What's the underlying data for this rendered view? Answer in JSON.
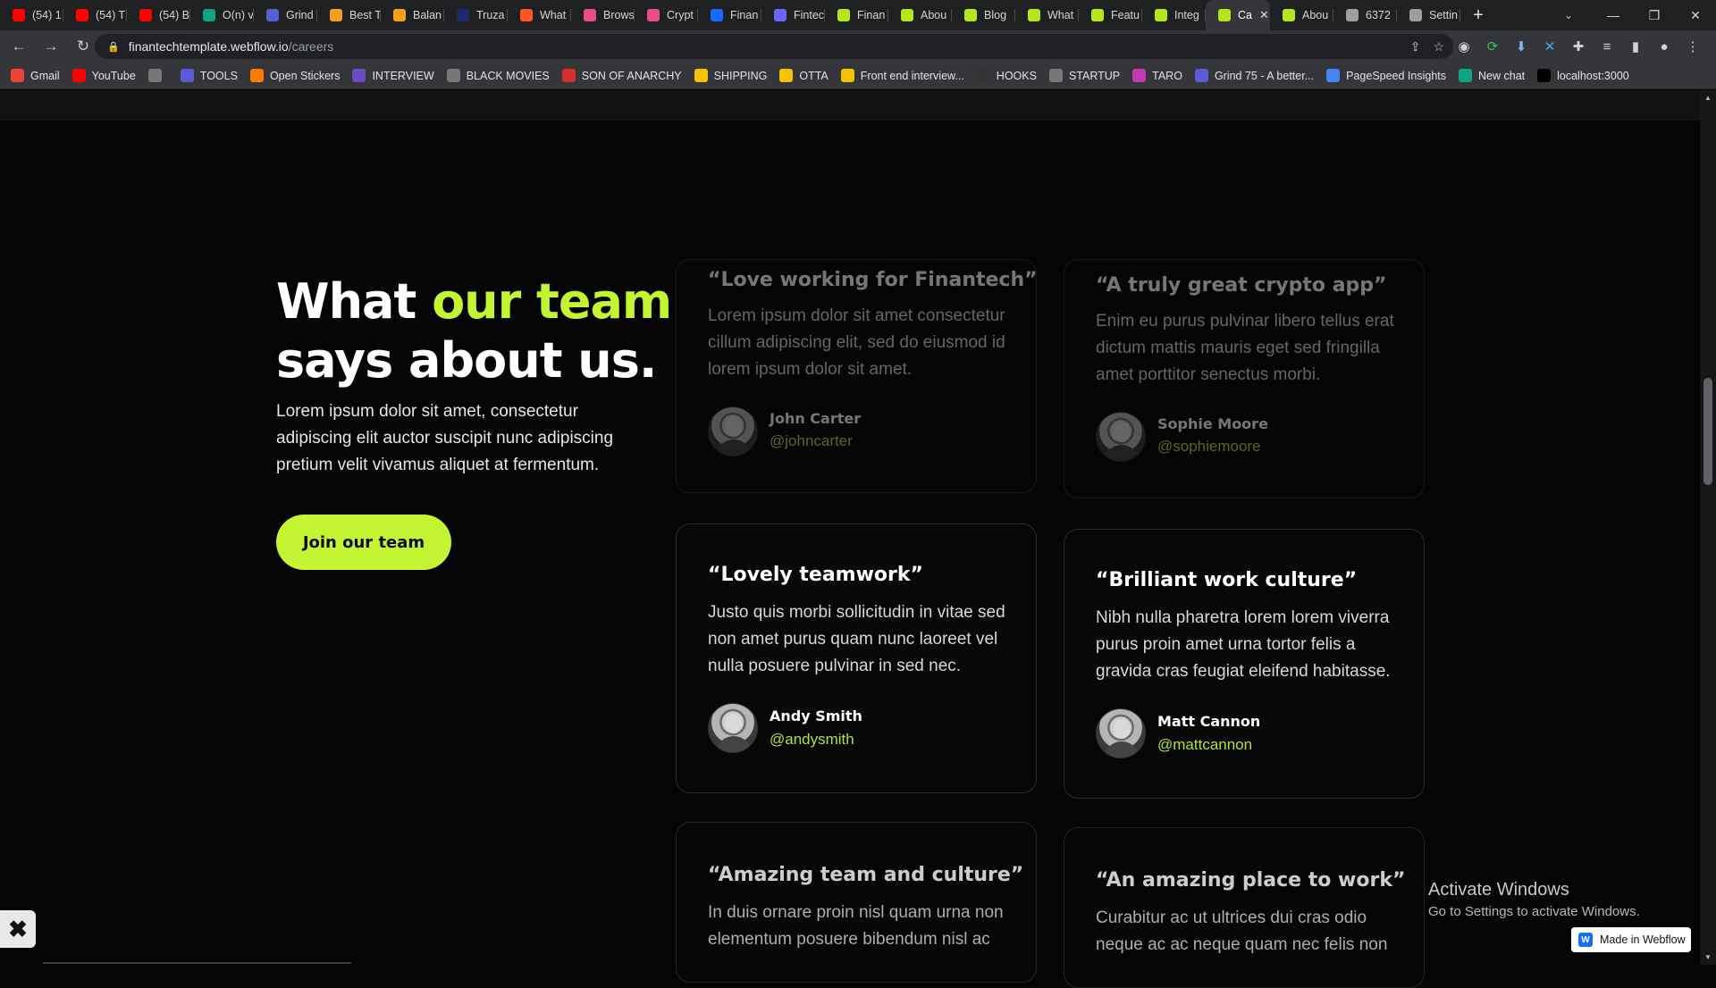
{
  "browser": {
    "tabs": [
      {
        "label": "(54) 1",
        "icon": "youtube-icon",
        "color": "#ff0000"
      },
      {
        "label": "(54) T",
        "icon": "youtube-icon",
        "color": "#ff0000"
      },
      {
        "label": "(54) B",
        "icon": "youtube-icon",
        "color": "#ff0000"
      },
      {
        "label": "O(n) v",
        "icon": "chatgpt-icon",
        "color": "#10a37f"
      },
      {
        "label": "Grind",
        "icon": "grind75-icon",
        "color": "#5b5bd6"
      },
      {
        "label": "Best T",
        "icon": "leetcode-icon",
        "color": "#f89f1b"
      },
      {
        "label": "Balan",
        "icon": "leetcode-icon",
        "color": "#f89f1b"
      },
      {
        "label": "Truza",
        "icon": "globe-icon",
        "color": "#1a2a6c"
      },
      {
        "label": "What",
        "icon": "alert-icon",
        "color": "#ff5722"
      },
      {
        "label": "Brows",
        "icon": "dribbble-icon",
        "color": "#ea4c89"
      },
      {
        "label": "Crypt",
        "icon": "dribbble-icon",
        "color": "#ea4c89"
      },
      {
        "label": "Finan",
        "icon": "behance-icon",
        "color": "#1769ff"
      },
      {
        "label": "Fintec",
        "icon": "dots-icon",
        "color": "#6c63ff"
      },
      {
        "label": "Finan",
        "icon": "finantech-icon",
        "color": "#b5e61d"
      },
      {
        "label": "Abou",
        "icon": "finantech-icon",
        "color": "#b5e61d"
      },
      {
        "label": "Blog",
        "icon": "finantech-icon",
        "color": "#b5e61d"
      },
      {
        "label": "What",
        "icon": "finantech-icon",
        "color": "#b5e61d"
      },
      {
        "label": "Featu",
        "icon": "finantech-icon",
        "color": "#b5e61d"
      },
      {
        "label": "Integ",
        "icon": "finantech-icon",
        "color": "#b5e61d"
      },
      {
        "label": "Ca",
        "icon": "finantech-icon",
        "color": "#b5e61d",
        "active": true
      },
      {
        "label": "Abou",
        "icon": "finantech-icon",
        "color": "#b5e61d"
      },
      {
        "label": "6372",
        "icon": "globe-icon",
        "color": "#9e9e9e"
      },
      {
        "label": "Settin",
        "icon": "gear-icon",
        "color": "#9e9e9e"
      }
    ],
    "url_host": "finantechtemplate.webflow.io",
    "url_path": "/careers",
    "bookmarks": [
      {
        "label": "Gmail",
        "color": "#ea4335"
      },
      {
        "label": "YouTube",
        "color": "#ff0000"
      },
      {
        "label": "",
        "color": "#777777"
      },
      {
        "label": "TOOLS",
        "color": "#5b5bd6"
      },
      {
        "label": "Open Stickers",
        "color": "#ff7a00"
      },
      {
        "label": "INTERVIEW",
        "color": "#6a4bc4"
      },
      {
        "label": "BLACK MOVIES",
        "color": "#777777"
      },
      {
        "label": "SON OF ANARCHY",
        "color": "#d32f2f"
      },
      {
        "label": "SHIPPING",
        "color": "#f5c400"
      },
      {
        "label": "OTTA",
        "color": "#f5c400"
      },
      {
        "label": "Front end interview...",
        "color": "#f5c400"
      },
      {
        "label": "HOOKS",
        "color": "#333333"
      },
      {
        "label": "STARTUP",
        "color": "#777777"
      },
      {
        "label": "TARO",
        "color": "#c239b3"
      },
      {
        "label": "Grind 75 - A better...",
        "color": "#5b5bd6"
      },
      {
        "label": "PageSpeed Insights",
        "color": "#4285f4"
      },
      {
        "label": "New chat",
        "color": "#10a37f"
      },
      {
        "label": "localhost:3000",
        "color": "#000000"
      }
    ]
  },
  "section": {
    "heading_pre": "What ",
    "heading_accent": "our team",
    "heading_post": "says about us.",
    "lead": "Lorem ipsum dolor sit amet, consectetur adipiscing elit auctor suscipit nunc adipiscing pretium velit vivamus aliquet at fermentum.",
    "cta": "Join our team",
    "accent_color": "#c3f532"
  },
  "testimonials": [
    {
      "title": "“Love working for Finantech”",
      "body": "Lorem ipsum dolor sit amet consectetur cillum adipiscing elit, sed do eiusmod  id lorem ipsum dolor sit amet.",
      "name": "John Carter",
      "handle": "@johncarter"
    },
    {
      "title": "“A truly great crypto app”",
      "body": "Enim eu purus pulvinar libero tellus erat dictum mattis mauris eget sed fringilla amet porttitor senectus morbi.",
      "name": "Sophie Moore",
      "handle": "@sophiemoore"
    },
    {
      "title": "“Lovely teamwork”",
      "body": "Justo quis morbi sollicitudin in vitae sed non amet purus quam nunc laoreet vel nulla posuere pulvinar in sed nec.",
      "name": "Andy Smith",
      "handle": "@andysmith"
    },
    {
      "title": "“Brilliant work culture”",
      "body": "Nibh nulla pharetra lorem lorem viverra purus proin amet urna tortor felis a gravida cras feugiat eleifend habitasse.",
      "name": "Matt Cannon",
      "handle": "@mattcannon"
    },
    {
      "title": "“Amazing team and culture”",
      "body": "In duis ornare proin nisl quam urna non elementum posuere bibendum nisl ac",
      "name": "",
      "handle": ""
    },
    {
      "title": "“An amazing place to work”",
      "body": "Curabitur ac ut ultrices dui cras odio neque ac ac neque quam nec felis non",
      "name": "",
      "handle": ""
    }
  ],
  "overlay": {
    "activate_title": "Activate Windows",
    "activate_sub": "Go to Settings to activate Windows.",
    "webflow_badge": "Made in Webflow"
  }
}
